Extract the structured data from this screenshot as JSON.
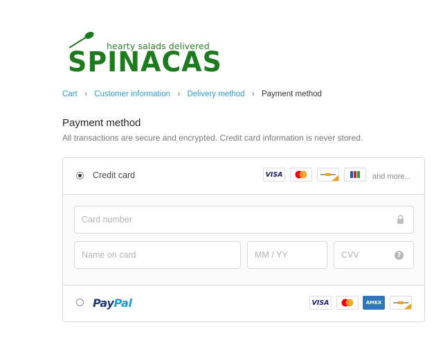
{
  "brand": {
    "tagline": "hearty salads delivered",
    "wordmark": "SPINACAS",
    "color": "#1e7a1e"
  },
  "breadcrumb": {
    "items": [
      {
        "label": "Cart"
      },
      {
        "label": "Customer information"
      },
      {
        "label": "Delivery method"
      },
      {
        "label": "Payment method"
      }
    ],
    "separator": "›"
  },
  "payment": {
    "title": "Payment method",
    "subtitle": "All transactions are secure and encrypted. Credit card information is never stored.",
    "credit_card": {
      "label": "Credit card",
      "selected": true,
      "brands": [
        "visa-icon",
        "mastercard-icon",
        "maestro-icon",
        "jcb-icon"
      ],
      "visa_text": "VISA",
      "more_text": "and more...",
      "fields": {
        "card_number": {
          "placeholder": "Card number",
          "value": ""
        },
        "name_on_card": {
          "placeholder": "Name on card",
          "value": ""
        },
        "expiry": {
          "placeholder": "MM / YY",
          "value": ""
        },
        "cvv": {
          "placeholder": "CVV",
          "value": ""
        },
        "cvv_help": "?"
      }
    },
    "paypal": {
      "label_pay": "Pay",
      "label_pal": "Pal",
      "selected": false,
      "brands": [
        "visa-icon",
        "mastercard-icon",
        "amex-icon",
        "maestro-icon"
      ],
      "visa_text": "VISA",
      "amex_text": "AMEX"
    }
  },
  "colors": {
    "link": "#2a9bc4",
    "border": "#d9d9d9",
    "paypal_dark": "#1b3a7a",
    "paypal_light": "#1f9ad6"
  }
}
